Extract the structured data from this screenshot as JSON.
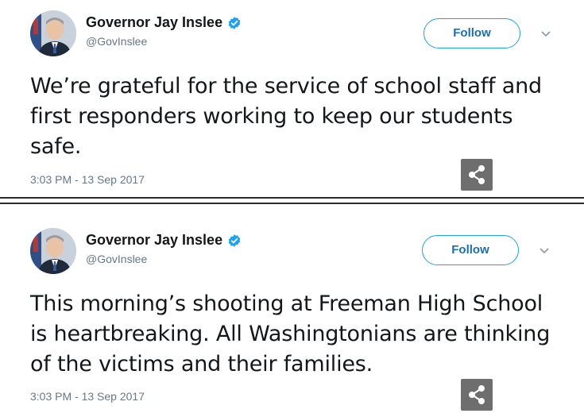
{
  "tweets": [
    {
      "display_name": "Governor Jay Inslee",
      "handle": "@GovInslee",
      "follow_label": "Follow",
      "text": "We’re grateful for the service of school staff and first responders working to keep our students safe.",
      "timestamp": "3:03 PM - 13 Sep 2017",
      "icons": {
        "verified": "verified-badge-icon",
        "caret": "chevron-down-icon",
        "share": "share-icon"
      }
    },
    {
      "display_name": "Governor Jay Inslee",
      "handle": "@GovInslee",
      "follow_label": "Follow",
      "text": "This morning’s shooting at Freeman High School is heartbreaking. All Washingtonians are thinking of the victims and their families.",
      "timestamp": "3:03 PM - 13 Sep 2017",
      "icons": {
        "verified": "verified-badge-icon",
        "caret": "chevron-down-icon",
        "share": "share-icon"
      }
    }
  ],
  "colors": {
    "accent": "#1da1f2",
    "follow_text": "#1a6fb0",
    "muted": "#657786",
    "text": "#14171a",
    "share_bg": "#6e6e6e",
    "divider": "#2b2b2b"
  }
}
